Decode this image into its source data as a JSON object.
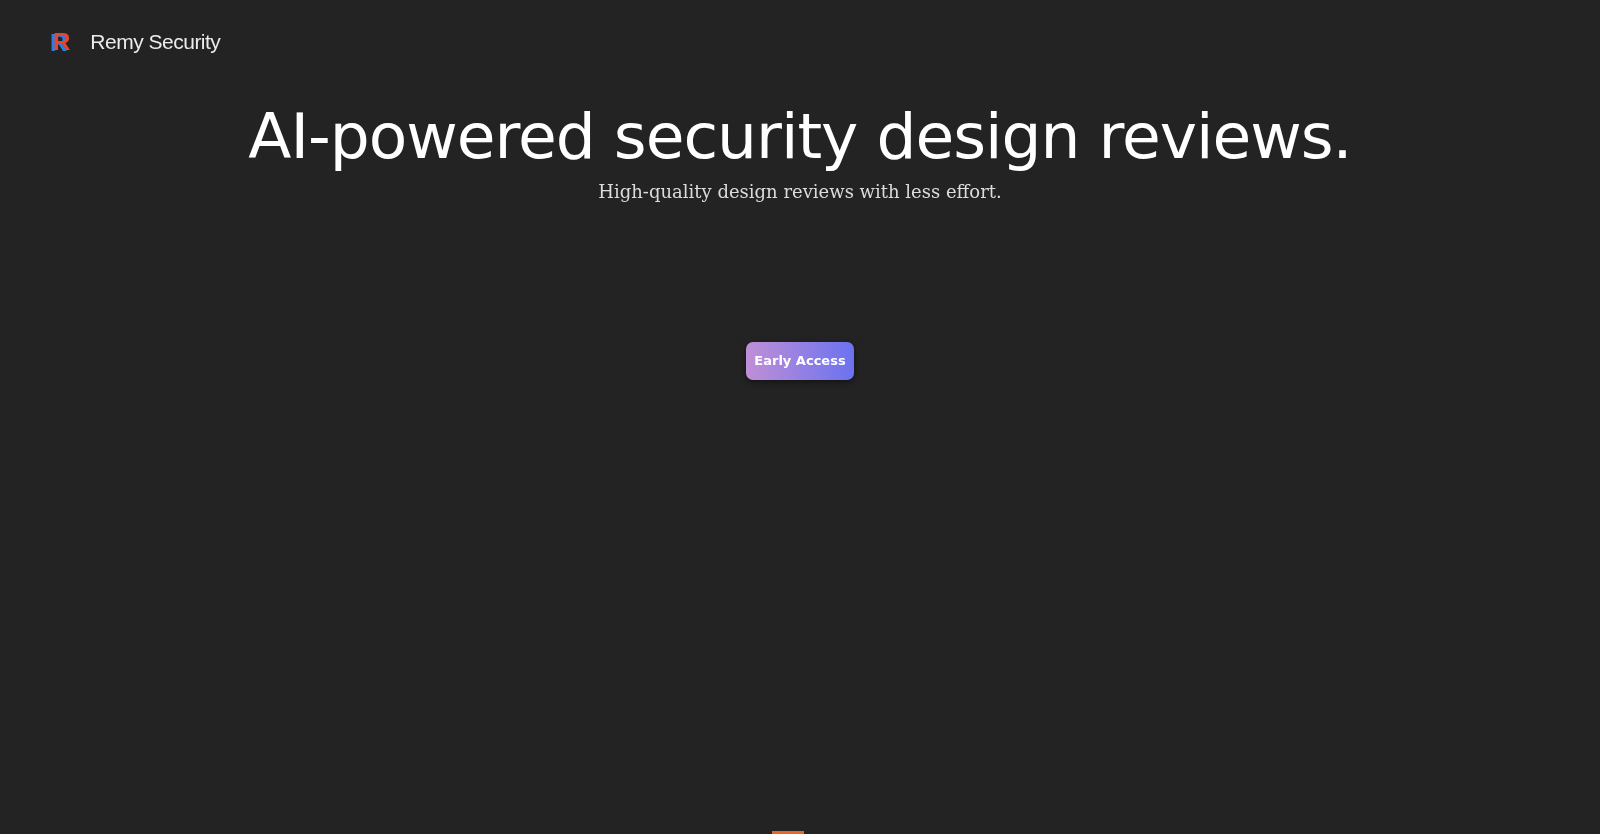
{
  "header": {
    "logo_letter": "R",
    "brand": "Remy Security"
  },
  "hero": {
    "title": "AI-powered security design reviews.",
    "subtitle": "High-quality design reviews with less effort."
  },
  "cta": {
    "label": "Early Access"
  }
}
